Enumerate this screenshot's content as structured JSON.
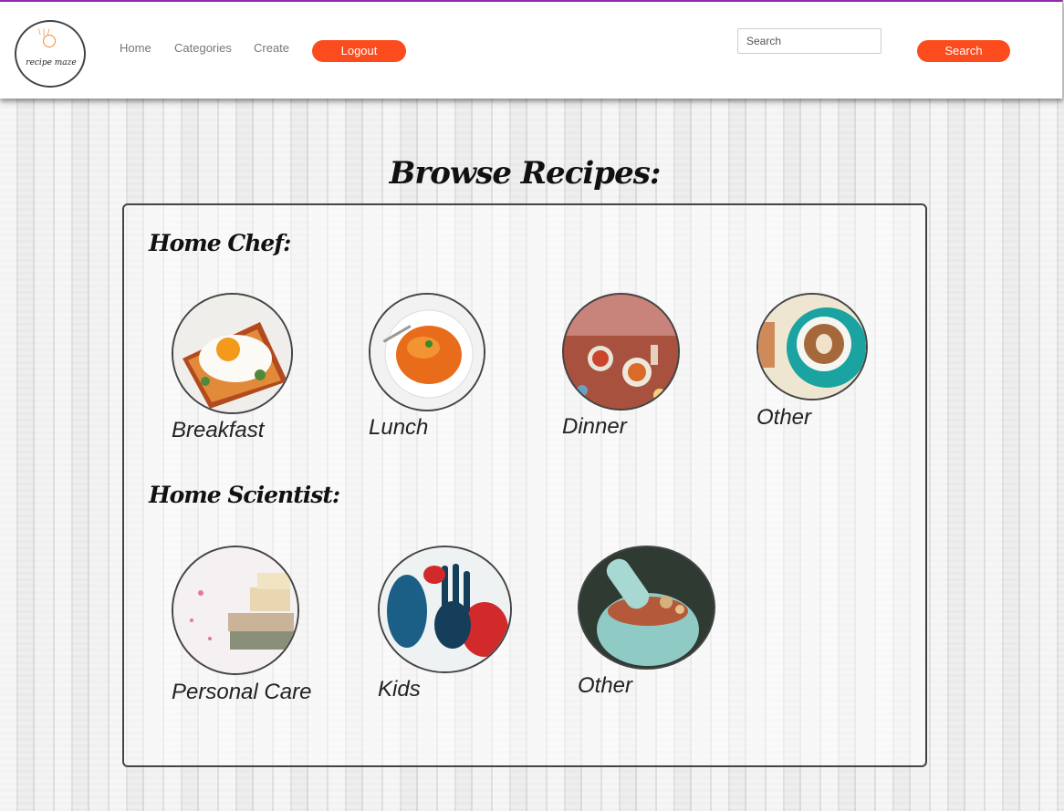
{
  "brand": {
    "logo_text": "recipe maze"
  },
  "nav": {
    "links": [
      "Home",
      "Categories",
      "Create"
    ],
    "logout_label": "Logout",
    "search_placeholder": "Search",
    "search_button": "Search"
  },
  "page": {
    "title": "Browse Recipes:"
  },
  "home_chef": {
    "title": "Home Chef:",
    "categories": [
      {
        "label": "Breakfast",
        "image": "fried-egg-toast"
      },
      {
        "label": "Lunch",
        "image": "pasta-plate"
      },
      {
        "label": "Dinner",
        "image": "dinner-table"
      },
      {
        "label": "Other",
        "image": "latte-cup"
      }
    ]
  },
  "home_scientist": {
    "title": "Home Scientist:",
    "categories": [
      {
        "label": "Personal Care",
        "image": "soap-towels"
      },
      {
        "label": "Kids",
        "image": "paint-handprints"
      },
      {
        "label": "Other",
        "image": "mortar-pestle"
      }
    ]
  },
  "colors": {
    "accent": "#fc4b1c",
    "top_border": "#8e2bb0"
  }
}
